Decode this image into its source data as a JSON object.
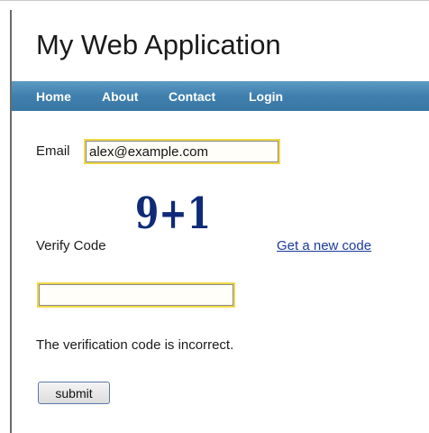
{
  "app": {
    "title": "My Web Application"
  },
  "nav": {
    "items": [
      {
        "label": "Home"
      },
      {
        "label": "About"
      },
      {
        "label": "Contact"
      },
      {
        "label": "Login"
      }
    ]
  },
  "form": {
    "email_label": "Email",
    "email_value": "alex@example.com",
    "captcha_text": "9+1",
    "verify_label": "Verify Code",
    "new_code_link": "Get a new code",
    "code_value": "",
    "error_message": "The verification code is incorrect.",
    "submit_label": "submit"
  },
  "colors": {
    "nav_bar": "#3f7fae",
    "link": "#1a3a9e",
    "captcha": "#0f2a78",
    "input_border": "#f0d94a"
  }
}
